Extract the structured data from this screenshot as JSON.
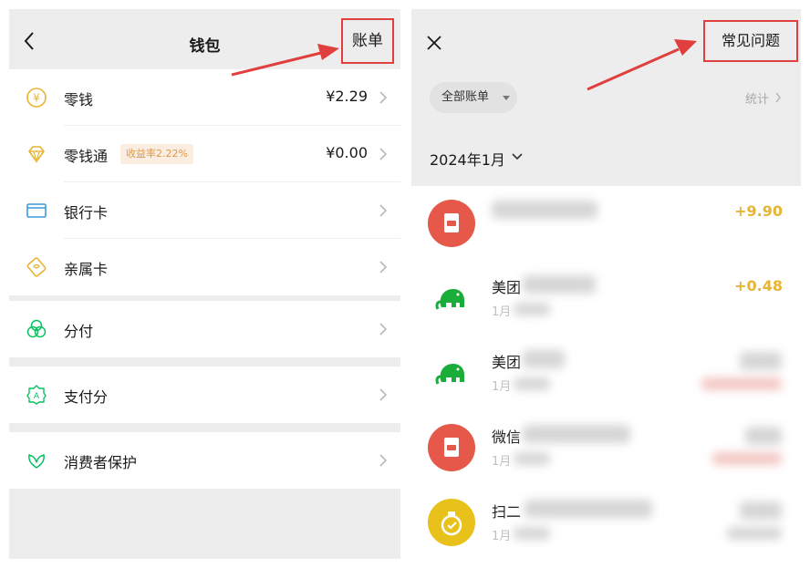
{
  "wallet": {
    "title": "钱包",
    "bill_button": "账单",
    "rows": [
      {
        "label": "零钱",
        "value": "¥2.29",
        "badge": ""
      },
      {
        "label": "零钱通",
        "value": "¥0.00",
        "badge": "收益率2.22%"
      },
      {
        "label": "银行卡",
        "value": "",
        "badge": ""
      },
      {
        "label": "亲属卡",
        "value": "",
        "badge": ""
      },
      {
        "label": "分付",
        "value": "",
        "badge": ""
      },
      {
        "label": "支付分",
        "value": "",
        "badge": ""
      },
      {
        "label": "消费者保护",
        "value": "",
        "badge": ""
      }
    ],
    "icons": [
      "coin-icon",
      "diamond-icon",
      "bank-card-icon",
      "family-card-icon",
      "installment-icon",
      "pay-score-icon",
      "consumer-protection-icon"
    ],
    "icon_color": "#e8b533",
    "green": "#07c160"
  },
  "bills": {
    "faq_button": "常见问题",
    "filter_label": "全部账单",
    "stats_label": "统计",
    "month_label": "2024年1月",
    "transactions": [
      {
        "name": "",
        "sub": "",
        "amount": "+9.90",
        "icon": "red-packet-icon"
      },
      {
        "name": "美团",
        "sub": "1月",
        "amount": "+0.48",
        "icon": "meituan-elephant-icon"
      },
      {
        "name": "美团",
        "sub": "1月",
        "amount": "",
        "icon": "meituan-elephant-icon"
      },
      {
        "name": "微信",
        "sub": "1月",
        "amount": "",
        "icon": "red-packet-icon"
      },
      {
        "name": "扫二",
        "sub": "1月",
        "amount": "",
        "icon": "scan-pay-icon"
      }
    ]
  },
  "annotation_color": "#e0403d"
}
